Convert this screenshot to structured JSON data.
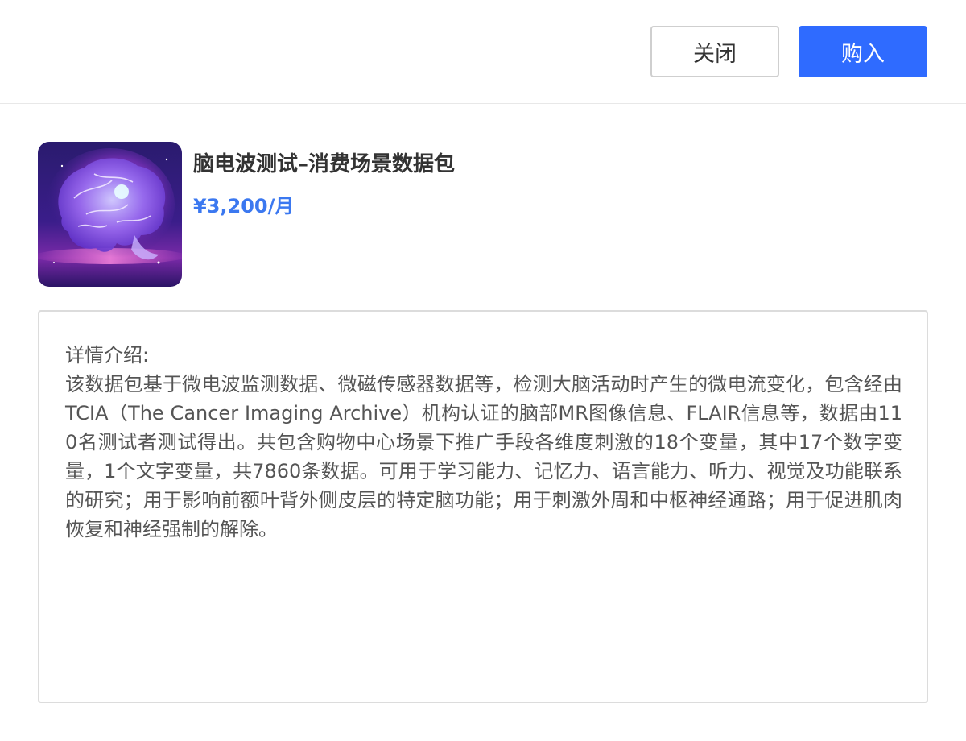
{
  "header": {
    "close_label": "关闭",
    "buy_label": "购入"
  },
  "product": {
    "image_icon": "brain-image",
    "title": "脑电波测试–消费场景数据包",
    "price": "¥3,200/月"
  },
  "details": {
    "heading": "详情介绍:",
    "text": "该数据包基于微电波监测数据、微磁传感器数据等，检测大脑活动时产生的微电流变化，包含经由TCIA（The Cancer Imaging Archive）机构认证的脑部MR图像信息、FLAIR信息等，数据由110名测试者测试得出。共包含购物中心场景下推广手段各维度刺激的18个变量，其中17个数字变量，1个文字变量，共7860条数据。可用于学习能力、记忆力、语言能力、听力、视觉及功能联系的研究；用于影响前额叶背外侧皮层的特定脑功能；用于刺激外周和中枢神经通路；用于促进肌肉恢复和神经强制的解除。"
  },
  "colors": {
    "accent": "#2f6bff",
    "price": "#3b78f0",
    "border": "#dcdcdc"
  }
}
